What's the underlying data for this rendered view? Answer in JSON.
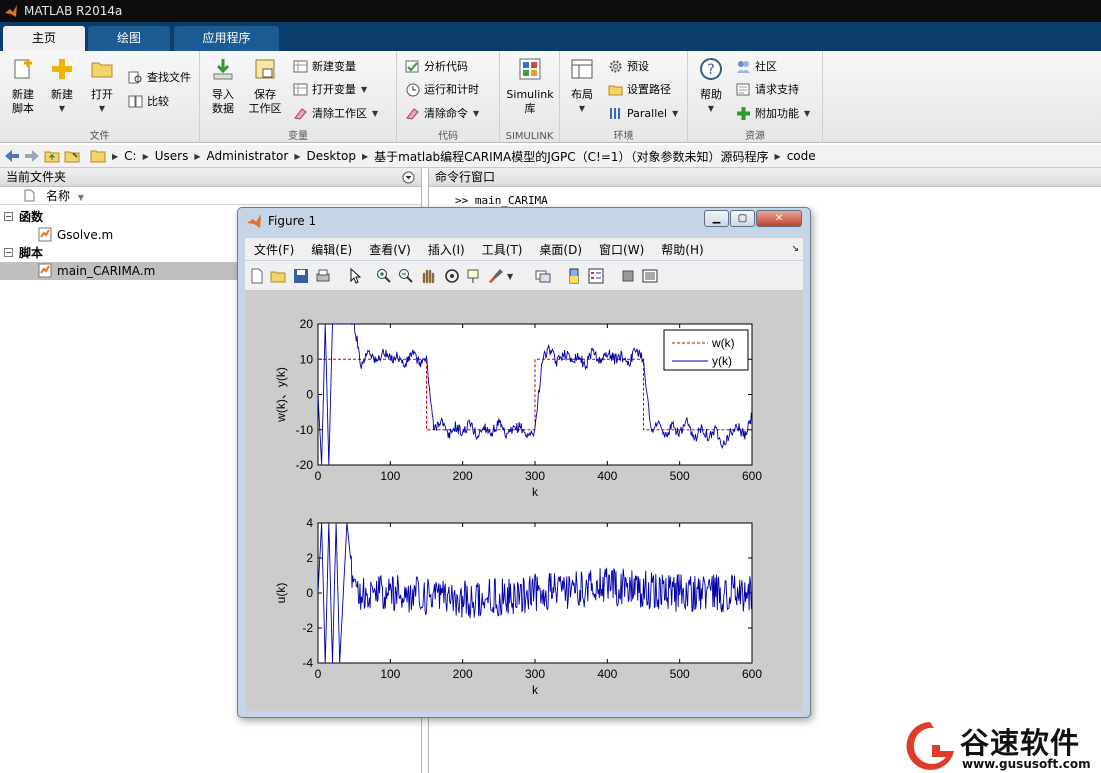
{
  "window": {
    "title": "MATLAB R2014a"
  },
  "tabs": [
    {
      "label": "主页",
      "active": true
    },
    {
      "label": "绘图",
      "active": false
    },
    {
      "label": "应用程序",
      "active": false
    }
  ],
  "ribbon": {
    "file": {
      "label": "文件",
      "new_script": "新建\n脚本",
      "new": "新建",
      "open": "打开",
      "find_files": "查找文件",
      "compare": "比较"
    },
    "variable": {
      "label": "变量",
      "import_data": "导入\n数据",
      "save_workspace": "保存\n工作区",
      "new_variable": "新建变量",
      "open_variable": "打开变量",
      "clear_workspace": "清除工作区"
    },
    "code": {
      "label": "代码",
      "analyze_code": "分析代码",
      "run_and_time": "运行和计时",
      "clear_commands": "清除命令"
    },
    "simulink": {
      "label": "SIMULINK",
      "library": "Simulink\n库"
    },
    "environment": {
      "label": "环境",
      "layout": "布局",
      "preferences": "预设",
      "set_path": "设置路径",
      "parallel": "Parallel"
    },
    "resources": {
      "label": "资源",
      "help": "帮助",
      "community": "社区",
      "request_support": "请求支持",
      "addons": "附加功能"
    }
  },
  "address": {
    "crumbs": [
      "C:",
      "Users",
      "Administrator",
      "Desktop",
      "基于matlab编程CARIMA模型的JGPC（C!=1）（对象参数未知）源码程序",
      "code"
    ]
  },
  "current_folder": {
    "title": "当前文件夹",
    "column_name": "名称",
    "groups": [
      {
        "label": "函数",
        "files": [
          "Gsolve.m"
        ]
      },
      {
        "label": "脚本",
        "files": [
          "main_CARIMA.m"
        ]
      }
    ]
  },
  "command_window": {
    "title": "命令行窗口",
    "prompt": ">>",
    "command": "main_CARIMA"
  },
  "figure": {
    "title": "Figure 1",
    "menus": [
      "文件(F)",
      "编辑(E)",
      "查看(V)",
      "插入(I)",
      "工具(T)",
      "桌面(D)",
      "窗口(W)",
      "帮助(H)"
    ]
  },
  "chart_data": [
    {
      "type": "line",
      "title": "",
      "xlabel": "k",
      "ylabel": "w(k)、y(k)",
      "xlim": [
        0,
        600
      ],
      "ylim": [
        -20,
        20
      ],
      "xticks": [
        0,
        100,
        200,
        300,
        400,
        500,
        600
      ],
      "yticks": [
        -20,
        -10,
        0,
        10,
        20
      ],
      "legend": "top-right",
      "series": [
        {
          "name": "w(k)",
          "style": "dashed",
          "color": "#cc0000",
          "x": [
            0,
            150,
            150,
            300,
            300,
            450,
            450,
            600
          ],
          "y": [
            10,
            10,
            -10,
            -10,
            10,
            10,
            -10,
            -10
          ]
        },
        {
          "name": "y(k)",
          "style": "solid",
          "color": "#0000aa",
          "x": [
            0,
            5,
            10,
            15,
            20,
            30,
            40,
            50,
            60,
            70,
            80,
            90,
            100,
            110,
            120,
            130,
            140,
            150,
            155,
            160,
            170,
            180,
            190,
            200,
            210,
            220,
            230,
            240,
            250,
            260,
            270,
            280,
            290,
            300,
            305,
            310,
            320,
            330,
            340,
            350,
            360,
            370,
            380,
            390,
            400,
            410,
            420,
            430,
            440,
            450,
            455,
            460,
            470,
            480,
            490,
            500,
            510,
            520,
            530,
            540,
            550,
            560,
            570,
            580,
            590,
            600
          ],
          "y": [
            0,
            -20,
            20,
            -20,
            20,
            20,
            20,
            20,
            8,
            13,
            9,
            12,
            10,
            11,
            8,
            12,
            9,
            10,
            0,
            -10,
            -7,
            -12,
            -9,
            -11,
            -8,
            -12,
            -9,
            -11,
            -8,
            -12,
            -10,
            -9,
            -12,
            -10,
            0,
            10,
            13,
            9,
            12,
            10,
            11,
            8,
            13,
            9,
            12,
            10,
            11,
            9,
            13,
            10,
            0,
            -10,
            -8,
            -12,
            -9,
            -11,
            -8,
            -13,
            -9,
            -12,
            -10,
            -14,
            -11,
            -9,
            -12,
            -6
          ]
        }
      ]
    },
    {
      "type": "line",
      "title": "",
      "xlabel": "k",
      "ylabel": "u(k)",
      "xlim": [
        0,
        600
      ],
      "ylim": [
        -4,
        4
      ],
      "xticks": [
        0,
        100,
        200,
        300,
        400,
        500,
        600
      ],
      "yticks": [
        -4,
        -2,
        0,
        2,
        4
      ],
      "series": [
        {
          "name": "",
          "style": "solid",
          "color": "#0000aa",
          "x": [
            0,
            5,
            10,
            15,
            20,
            25,
            30,
            40,
            45,
            50,
            100,
            200,
            300,
            400,
            500,
            600
          ],
          "y": [
            0,
            4,
            -4,
            4,
            -4,
            4,
            -4,
            4,
            2,
            0,
            0,
            -0.4,
            0,
            0.4,
            0,
            0
          ]
        }
      ]
    }
  ],
  "watermark": {
    "text": "谷速软件",
    "url": "www.gususoft.com"
  }
}
